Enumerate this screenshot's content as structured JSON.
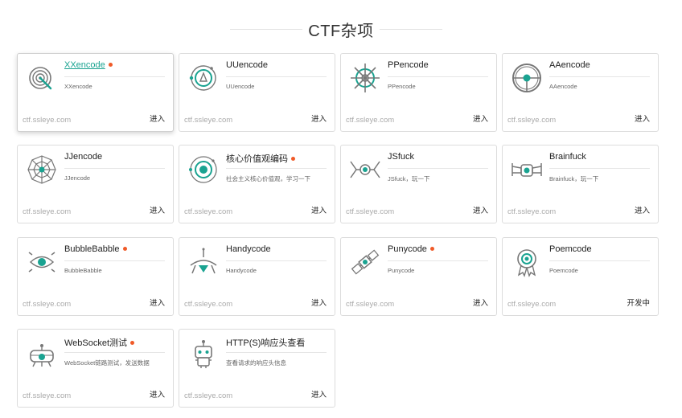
{
  "header": {
    "title": "CTF杂项"
  },
  "theme": {
    "accent": "#1aa391",
    "dot": "#f05a28",
    "icon_stroke": "#777777"
  },
  "cards": [
    {
      "name": "XXencode",
      "desc": "XXencode",
      "domain": "ctf.ssleye.com",
      "action": "进入",
      "icon": "xx-target-icon",
      "hot": true
    },
    {
      "name": "UUencode",
      "desc": "UUencode",
      "domain": "ctf.ssleye.com",
      "action": "进入",
      "icon": "uu-orbit-icon",
      "hot": false
    },
    {
      "name": "PPencode",
      "desc": "PPencode",
      "domain": "ctf.ssleye.com",
      "action": "进入",
      "icon": "ship-wheel-icon",
      "hot": false
    },
    {
      "name": "AAencode",
      "desc": "AAencode",
      "domain": "ctf.ssleye.com",
      "action": "进入",
      "icon": "steering-wheel-icon",
      "hot": false
    },
    {
      "name": "JJencode",
      "desc": "JJencode",
      "domain": "ctf.ssleye.com",
      "action": "进入",
      "icon": "spider-web-icon",
      "hot": false
    },
    {
      "name": "核心价值观编码",
      "desc": "社会主义核心价值观，学习一下",
      "domain": "ctf.ssleye.com",
      "action": "进入",
      "icon": "planet-orbit-icon",
      "hot": true
    },
    {
      "name": "JSfuck",
      "desc": "JSfuck，玩一下",
      "domain": "ctf.ssleye.com",
      "action": "进入",
      "icon": "tie-fighter-icon",
      "hot": false
    },
    {
      "name": "Brainfuck",
      "desc": "Brainfuck，玩一下",
      "domain": "ctf.ssleye.com",
      "action": "进入",
      "icon": "starfighter-icon",
      "hot": false
    },
    {
      "name": "BubbleBabble",
      "desc": "BubbleBabble",
      "domain": "ctf.ssleye.com",
      "action": "进入",
      "icon": "eye-icon",
      "hot": true
    },
    {
      "name": "Handycode",
      "desc": "Handycode",
      "domain": "ctf.ssleye.com",
      "action": "进入",
      "icon": "lander-icon",
      "hot": false
    },
    {
      "name": "Punycode",
      "desc": "Punycode",
      "domain": "ctf.ssleye.com",
      "action": "进入",
      "icon": "satellite-icon",
      "hot": true
    },
    {
      "name": "Poemcode",
      "desc": "Poemcode",
      "domain": "ctf.ssleye.com",
      "action": "开发中",
      "icon": "medal-icon",
      "hot": false
    },
    {
      "name": "WebSocket测试",
      "desc": "WebSocket链路测试，发送数据",
      "domain": "ctf.ssleye.com",
      "action": "进入",
      "icon": "ufo-icon",
      "hot": true
    },
    {
      "name": "HTTP(S)响应头查看",
      "desc": "查看请求的响应头信息",
      "domain": "ctf.ssleye.com",
      "action": "进入",
      "icon": "robot-icon",
      "hot": false
    }
  ]
}
